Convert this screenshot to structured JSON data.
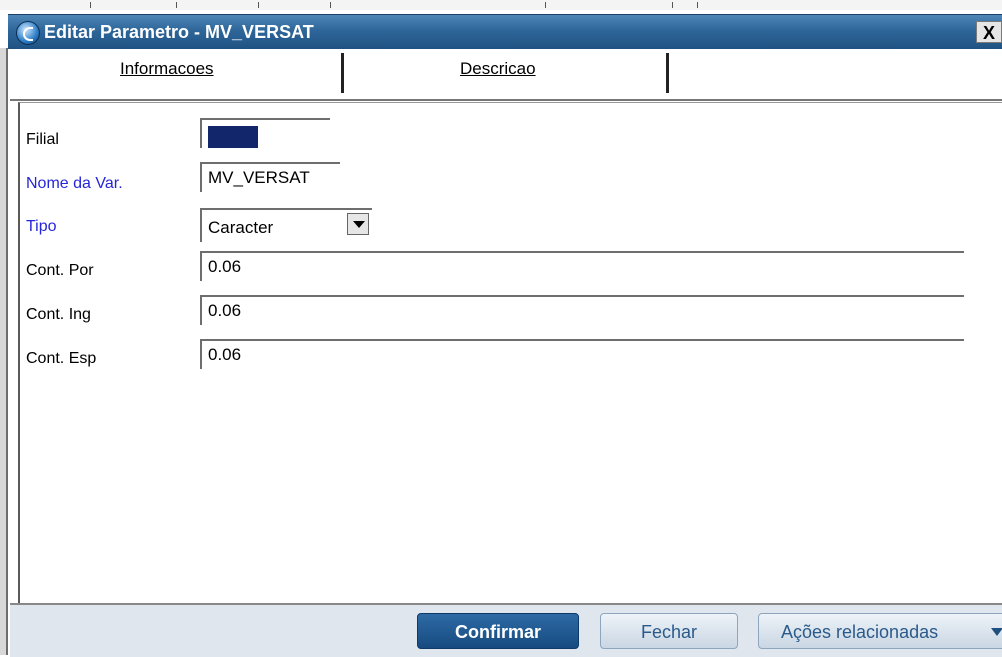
{
  "window": {
    "title": "Editar Parametro - MV_VERSAT",
    "close_label": "X"
  },
  "tabs": [
    {
      "label": "Informacoes",
      "active": true
    },
    {
      "label": "Descricao",
      "active": false
    }
  ],
  "form": {
    "filial": {
      "label": "Filial",
      "value": ""
    },
    "nome_var": {
      "label": "Nome da Var.",
      "value": "MV_VERSAT"
    },
    "tipo": {
      "label": "Tipo",
      "value": "Caracter"
    },
    "cont_por": {
      "label": "Cont. Por",
      "value": "0.06"
    },
    "cont_ing": {
      "label": "Cont. Ing",
      "value": "0.06"
    },
    "cont_esp": {
      "label": "Cont. Esp",
      "value": "0.06"
    }
  },
  "footer": {
    "confirm_label": "Confirmar",
    "close_label": "Fechar",
    "actions_label": "Ações relacionadas"
  },
  "colors": {
    "title_bar": "#2e6699",
    "required_label": "#2626d9",
    "filial_fill": "#12276b",
    "confirm_button": "#164b80"
  }
}
